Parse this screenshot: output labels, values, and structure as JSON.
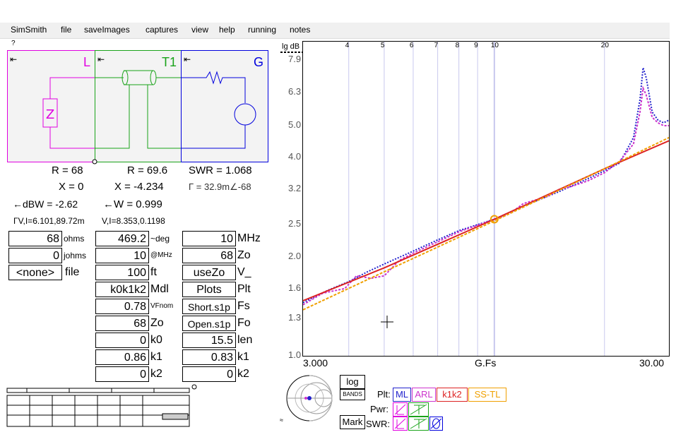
{
  "menu": {
    "items": [
      "SimSmith",
      "file",
      "saveImages",
      "captures",
      "view",
      "help",
      "running",
      "notes"
    ]
  },
  "help_mark": "?",
  "schematic": {
    "blocks": [
      {
        "label": "L",
        "color": "#e000e0",
        "arrow": "⇤"
      },
      {
        "label": "T1",
        "color": "#1aa31a",
        "arrow": "⇤"
      },
      {
        "label": "G",
        "color": "#0000dd",
        "arrow": "⇤"
      }
    ]
  },
  "readouts": {
    "r_load": "R = 68",
    "x_load": "X = 0",
    "dbw": "←dBW = -2.62",
    "vi_load": "ΓV,I=6.101,89.72m",
    "r_t1": "R = 69.6",
    "x_t1": "X = -4.234",
    "w_t1": "←W = 0.999",
    "vi_t1": "V,I=8.353,0.1198",
    "swr": "SWR = 1.068",
    "gamma": "Γ = 32.9m∠-68"
  },
  "load_fields": [
    {
      "value": "68",
      "label": "ohms"
    },
    {
      "value": "0",
      "label": "johms"
    },
    {
      "value": "<none>",
      "label": "file"
    }
  ],
  "t1_fields": [
    {
      "value": "469.2",
      "label": "~deg"
    },
    {
      "value": "10",
      "label": "@MHz"
    },
    {
      "value": "100",
      "label": "ft"
    },
    {
      "value": "k0k1k2",
      "label": "Mdl"
    },
    {
      "value": "0.78",
      "label": "VFnom"
    },
    {
      "value": "68",
      "label": "Zo"
    },
    {
      "value": "0",
      "label": "k0"
    },
    {
      "value": "0.86",
      "label": "k1"
    },
    {
      "value": "0",
      "label": "k2"
    }
  ],
  "g_fields": [
    {
      "value": "10",
      "label": "MHz"
    },
    {
      "value": "68",
      "label": "Zo"
    },
    {
      "value": "useZo",
      "label": "V_"
    },
    {
      "value": "Plots",
      "label": "Plt"
    },
    {
      "value": "Short.s1p",
      "label": "Fs"
    },
    {
      "value": "Open.s1p",
      "label": "Fo"
    },
    {
      "value": "15.5",
      "label": "len"
    },
    {
      "value": "0.83",
      "label": "k1"
    },
    {
      "value": "0",
      "label": "k2"
    }
  ],
  "chart_data": {
    "type": "line",
    "ylabel": "lg dB",
    "xlabel": "G.Fs",
    "x_axis_labels": [
      "3.000",
      "30.00"
    ],
    "x_log_range": [
      3,
      30
    ],
    "top_ticks": [
      "4",
      "5",
      "6",
      "7",
      "8",
      "9",
      "10",
      "20"
    ],
    "top_tick_values": [
      4,
      5,
      6,
      7,
      8,
      9,
      10,
      20
    ],
    "y_ticks": [
      "7.9",
      "6.3",
      "5.0",
      "4.0",
      "3.2",
      "2.5",
      "2.0",
      "1.6",
      "1.3",
      "1.0"
    ],
    "y_tick_values": [
      7.9,
      6.3,
      5.0,
      4.0,
      3.2,
      2.5,
      2.0,
      1.6,
      1.3,
      1.0
    ],
    "ylim": [
      1.0,
      9.0
    ],
    "series": [
      {
        "name": "ML",
        "color": "#2222cc",
        "dash": "2,2",
        "points": [
          [
            3,
            1.45
          ],
          [
            3.5,
            1.58
          ],
          [
            4,
            1.68
          ],
          [
            4.5,
            1.8
          ],
          [
            5,
            1.9
          ],
          [
            6,
            2.08
          ],
          [
            7,
            2.25
          ],
          [
            8,
            2.4
          ],
          [
            10,
            2.6
          ],
          [
            12,
            2.85
          ],
          [
            15,
            3.15
          ],
          [
            18,
            3.45
          ],
          [
            20,
            3.65
          ],
          [
            22,
            3.85
          ],
          [
            24,
            4.6
          ],
          [
            25,
            6.0
          ],
          [
            25.5,
            7.5
          ],
          [
            26,
            7.0
          ],
          [
            27,
            5.5
          ],
          [
            28,
            5.2
          ],
          [
            29,
            5.1
          ],
          [
            30,
            5.2
          ]
        ]
      },
      {
        "name": "ARL",
        "color": "#cc33cc",
        "dash": "3,2",
        "points": [
          [
            3,
            1.43
          ],
          [
            3.4,
            1.55
          ],
          [
            3.9,
            1.6
          ],
          [
            4.2,
            1.75
          ],
          [
            4.6,
            1.72
          ],
          [
            5,
            1.75
          ],
          [
            5.5,
            1.95
          ],
          [
            6,
            2.05
          ],
          [
            7,
            2.22
          ],
          [
            8,
            2.38
          ],
          [
            10,
            2.6
          ],
          [
            11,
            2.7
          ],
          [
            12,
            2.9
          ],
          [
            14,
            3.05
          ],
          [
            15,
            3.2
          ],
          [
            16,
            3.25
          ],
          [
            18,
            3.4
          ],
          [
            20,
            3.6
          ],
          [
            22,
            3.9
          ],
          [
            24,
            4.4
          ],
          [
            25,
            5.5
          ],
          [
            25.5,
            6.5
          ],
          [
            26,
            6.2
          ],
          [
            27,
            5.3
          ],
          [
            28,
            5.1
          ],
          [
            29,
            5.0
          ],
          [
            30,
            5.0
          ]
        ]
      },
      {
        "name": "k1k2",
        "color": "#dd2222",
        "dash": "",
        "points": [
          [
            3,
            1.47
          ],
          [
            5,
            1.85
          ],
          [
            10,
            2.6
          ],
          [
            20,
            3.7
          ],
          [
            30,
            4.5
          ]
        ]
      },
      {
        "name": "SS-TL",
        "color": "#f0a000",
        "dash": "4,2",
        "points": [
          [
            3,
            1.38
          ],
          [
            5,
            1.8
          ],
          [
            10,
            2.57
          ],
          [
            20,
            3.7
          ],
          [
            30,
            4.6
          ]
        ]
      }
    ],
    "marker": {
      "x": 10,
      "y": 2.6,
      "color": "#f0a000"
    }
  },
  "plot_buttons": {
    "log": "log",
    "bands": "BANDS",
    "mark": "Mark",
    "plt_label": "Plt:",
    "pwr_label": "Pwr:",
    "swr_label": "SWR:"
  },
  "plt_buttons": [
    {
      "label": "ML",
      "color": "#2222cc"
    },
    {
      "label": "ARL",
      "color": "#cc33cc"
    },
    {
      "label": "k1k2",
      "color": "#dd2222"
    },
    {
      "label": "SS-TL",
      "color": "#f0a000"
    }
  ]
}
